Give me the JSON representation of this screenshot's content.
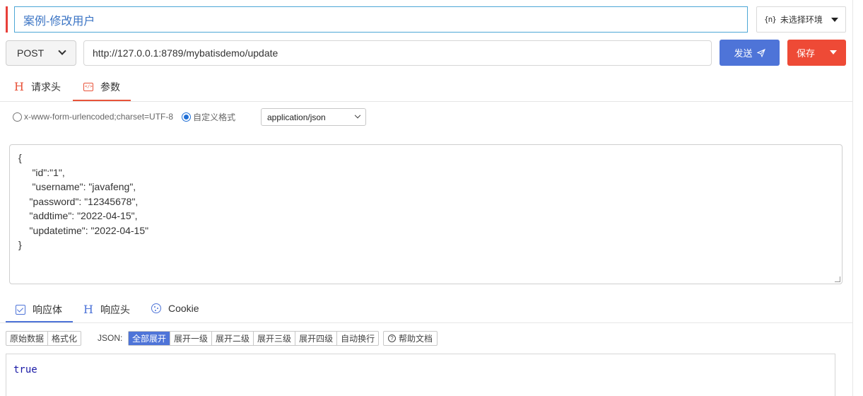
{
  "request": {
    "name": "案例-修改用户",
    "environment_label": "未选择环境",
    "environment_icon": "{n}",
    "method": "POST",
    "url": "http://127.0.0.1:8789/mybatisdemo/update",
    "send_label": "发送",
    "save_label": "保存"
  },
  "request_tabs": {
    "headers": "请求头",
    "params": "参数",
    "active": "params"
  },
  "body_options": {
    "form_label": "x-www-form-urlencoded;charset=UTF-8",
    "custom_label": "自定义格式",
    "selected": "custom",
    "content_type": "application/json"
  },
  "body_lines": [
    "{",
    "     \"id\":\"1\",",
    "     \"username\": \"javafeng\",",
    "    \"password\": \"12345678\",",
    "    \"addtime\": \"2022-04-15\",",
    "    \"updatetime\": \"2022-04-15\"",
    "}"
  ],
  "response_tabs": {
    "body": "响应体",
    "headers": "响应头",
    "cookie": "Cookie",
    "active": "body"
  },
  "response_toolbar": {
    "raw": "原始数据",
    "format": "格式化",
    "json_label": "JSON:",
    "expand_all": "全部展开",
    "expand_1": "展开一级",
    "expand_2": "展开二级",
    "expand_3": "展开三级",
    "expand_4": "展开四级",
    "wrap": "自动换行",
    "help": "帮助文档",
    "active": "expand_all"
  },
  "response_body": "true",
  "colors": {
    "primary": "#4e74d8",
    "danger": "#ee4a36",
    "accent": "#e8533a"
  }
}
